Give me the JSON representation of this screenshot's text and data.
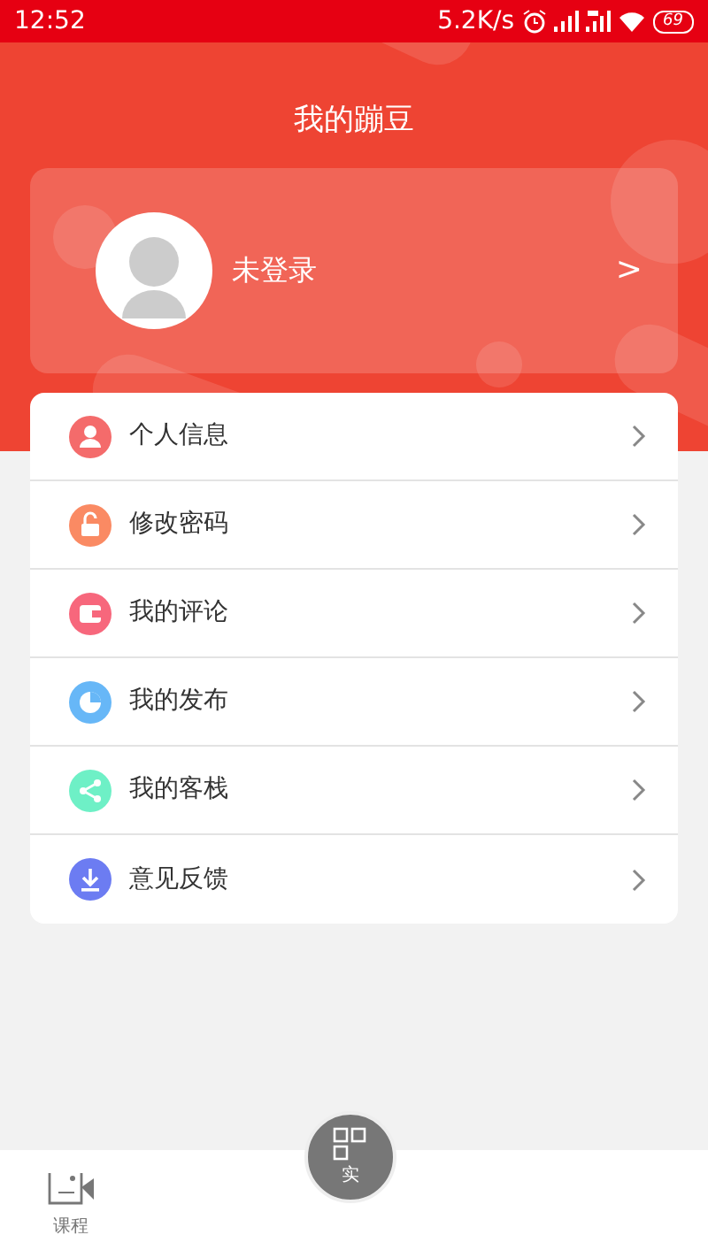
{
  "status_bar": {
    "time": "12:52",
    "speed": "5.2K/s",
    "battery": "69"
  },
  "header": {
    "title": "我的蹦豆"
  },
  "profile": {
    "name": "未登录",
    "chevron": ">"
  },
  "menu": [
    {
      "label": "个人信息",
      "kind": "person",
      "color": "#f46b6b"
    },
    {
      "label": "修改密码",
      "kind": "lock",
      "color": "#fa8a63"
    },
    {
      "label": "我的评论",
      "kind": "wallet",
      "color": "#f7677c"
    },
    {
      "label": "我的发布",
      "kind": "pie",
      "color": "#67b7f7"
    },
    {
      "label": "我的客栈",
      "kind": "share",
      "color": "#6ef0c6"
    },
    {
      "label": "意见反馈",
      "kind": "download",
      "color": "#6c7cf2"
    }
  ],
  "bottom_nav": [
    {
      "label": "课程",
      "kind": "tab",
      "selected": false
    },
    {
      "label": "实",
      "kind": "center",
      "selected": false
    }
  ]
}
